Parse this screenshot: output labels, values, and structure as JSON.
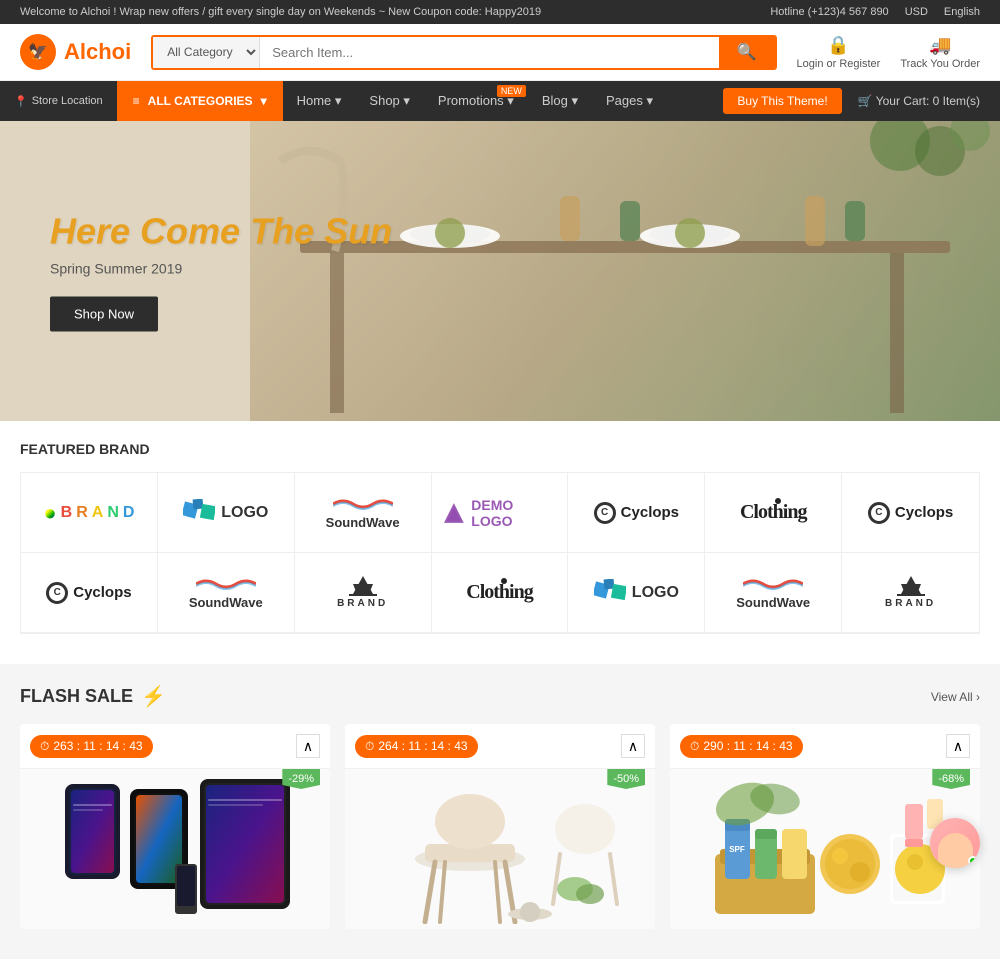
{
  "topbar": {
    "announcement": "Welcome to Alchoi ! Wrap new offers / gift every single day on Weekends ~ New Coupon code: Happy2019",
    "hotline_label": "Hotline (+123)4 567 890",
    "currency": "USD",
    "language": "English"
  },
  "header": {
    "logo_text": "Alchoi",
    "search_category_label": "All Category",
    "search_placeholder": "Search Item...",
    "login_label": "Login or Register",
    "track_label": "Track You Order",
    "store_label": "Store Location"
  },
  "nav": {
    "all_categories": "ALL CATEGORIES",
    "links": [
      {
        "label": "Home",
        "has_dropdown": true
      },
      {
        "label": "Shop",
        "has_dropdown": true
      },
      {
        "label": "Promotions",
        "has_dropdown": true,
        "badge": "NEW"
      },
      {
        "label": "Blog",
        "has_dropdown": true
      },
      {
        "label": "Pages",
        "has_dropdown": true
      }
    ],
    "buy_theme": "Buy This Theme!",
    "your_cart": "Your Cart:",
    "cart_count": "0 Item(s)"
  },
  "hero": {
    "title": "Here Come The Sun",
    "subtitle": "Spring Summer 2019",
    "cta_button": "Shop Now"
  },
  "featured_brands": {
    "section_title": "FEATURED BRAND",
    "row1": [
      {
        "type": "apple-brand",
        "text": "BRAND"
      },
      {
        "type": "blue-logo",
        "text": "LOGO"
      },
      {
        "type": "soundwave",
        "text": "SoundWave"
      },
      {
        "type": "demo-logo",
        "text": "DEMO LOGO"
      },
      {
        "type": "cyclops",
        "text": "Cyclops"
      },
      {
        "type": "clothing",
        "text": "Clothing"
      },
      {
        "type": "cyclops",
        "text": "Cyclops"
      }
    ],
    "row2": [
      {
        "type": "cyclops",
        "text": "Cyclops"
      },
      {
        "type": "soundwave",
        "text": "SoundWave"
      },
      {
        "type": "star-brand",
        "text": "BRAND"
      },
      {
        "type": "clothing",
        "text": "Clothing"
      },
      {
        "type": "blue-logo",
        "text": "LOGO"
      },
      {
        "type": "soundwave",
        "text": "SoundWave"
      },
      {
        "type": "star-brand",
        "text": "BRAND"
      }
    ]
  },
  "flash_sale": {
    "section_title": "FLASH SALE",
    "view_all": "View All",
    "products": [
      {
        "timer": "263 : 11 : 14 : 43",
        "discount": "-29%",
        "category": "Electronics",
        "type": "phones"
      },
      {
        "timer": "264 : 11 : 14 : 43",
        "discount": "-50%",
        "category": "Furniture",
        "type": "chair"
      },
      {
        "timer": "290 : 11 : 14 : 43",
        "discount": "-68%",
        "category": "Beauty",
        "type": "bath"
      }
    ]
  }
}
